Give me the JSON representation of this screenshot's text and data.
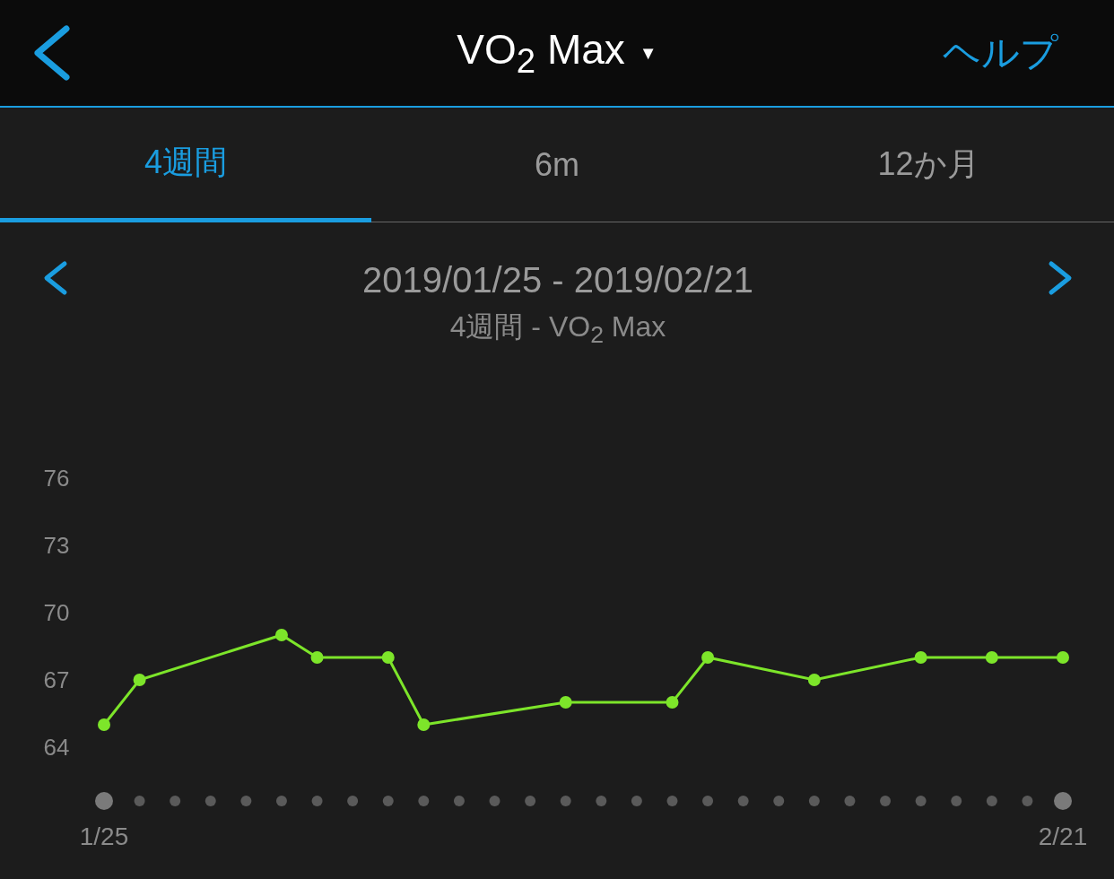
{
  "header": {
    "title": "VO$_{2}$ Max",
    "caret": "▼",
    "help": "ヘルプ"
  },
  "tabs": [
    {
      "label": "4週間",
      "selected": true
    },
    {
      "label": "6m",
      "selected": false
    },
    {
      "label": "12か月",
      "selected": false
    }
  ],
  "range": {
    "dates": "2019/01/25 - 2019/02/21",
    "subtitle": "4週間 - VO$_{2}$ Max"
  },
  "chart_data": {
    "type": "line",
    "categories": [
      "1/25",
      null,
      null,
      null,
      null,
      null,
      null,
      null,
      null,
      null,
      null,
      null,
      null,
      null,
      null,
      null,
      null,
      null,
      null,
      null,
      null,
      null,
      null,
      null,
      null,
      null,
      null,
      "2/21"
    ],
    "ylim": [
      64,
      76
    ],
    "yticks": [
      64,
      67,
      70,
      73,
      76
    ],
    "series": [
      {
        "color": "#7de52a",
        "marker": "circle",
        "values": [
          65,
          67,
          null,
          null,
          null,
          69,
          68,
          null,
          68,
          65,
          null,
          null,
          null,
          66,
          null,
          null,
          66,
          68,
          null,
          null,
          67,
          null,
          null,
          68,
          null,
          68,
          null,
          68
        ]
      }
    ]
  }
}
